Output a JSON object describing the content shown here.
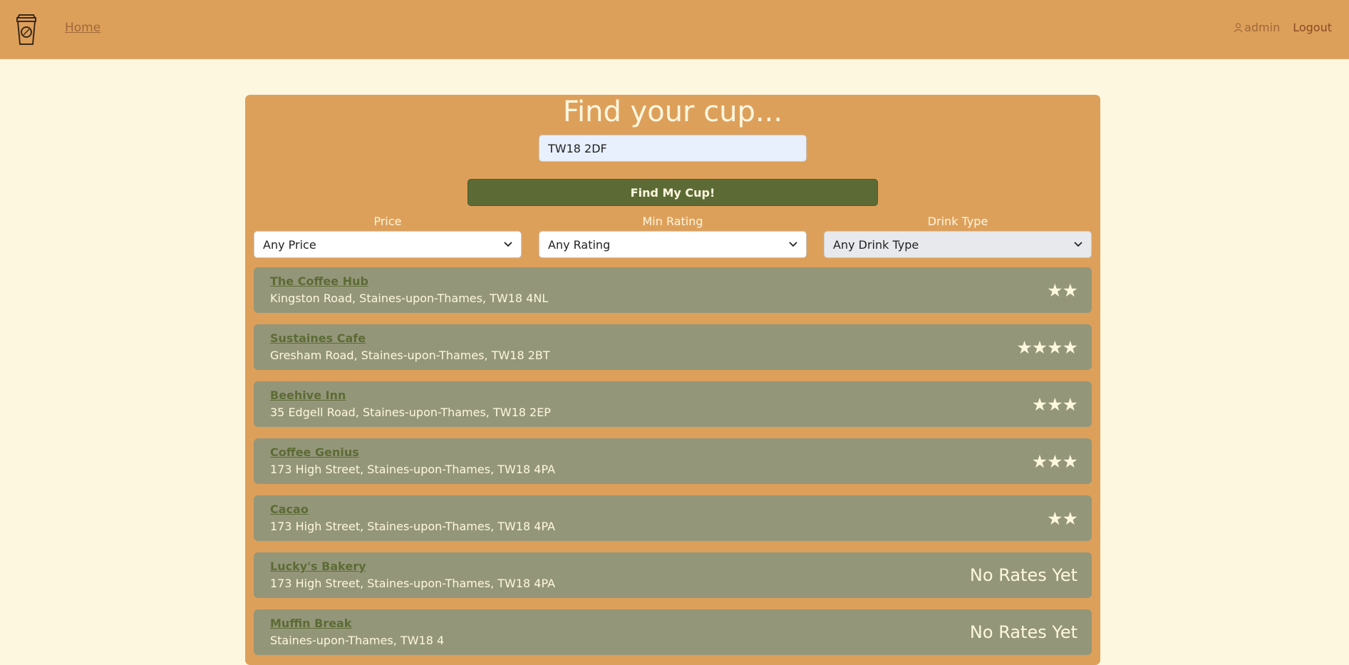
{
  "nav": {
    "home_label": "Home",
    "user_label": "admin",
    "logout_label": "Logout"
  },
  "search": {
    "title": "Find your cup...",
    "postcode_value": "TW18 2DF",
    "button_label": "Find My Cup!"
  },
  "filters": [
    {
      "label": "Price",
      "selected": "Any Price"
    },
    {
      "label": "Min Rating",
      "selected": "Any Rating"
    },
    {
      "label": "Drink Type",
      "selected": "Any Drink Type"
    }
  ],
  "results": [
    {
      "name": "The Coffee Hub",
      "address": "Kingston Road, Staines-upon-Thames, TW18 4NL",
      "rating": "★★"
    },
    {
      "name": "Sustaines Cafe",
      "address": "Gresham Road, Staines-upon-Thames, TW18 2BT",
      "rating": "★★★★"
    },
    {
      "name": "Beehive Inn",
      "address": "35 Edgell Road, Staines-upon-Thames, TW18 2EP",
      "rating": "★★★"
    },
    {
      "name": "Coffee Genius",
      "address": "173 High Street, Staines-upon-Thames, TW18 4PA",
      "rating": "★★★"
    },
    {
      "name": "Cacao",
      "address": "173 High Street, Staines-upon-Thames, TW18 4PA",
      "rating": "★★"
    },
    {
      "name": "Lucky's Bakery",
      "address": "173 High Street, Staines-upon-Thames, TW18 4PA",
      "rating": "No Rates Yet"
    },
    {
      "name": "Muffin Break",
      "address": "Staines-upon-Thames, TW18 4",
      "rating": "No Rates Yet"
    }
  ],
  "colors": {
    "background": "#fdf7df",
    "navbar": "#dda05b",
    "panel": "#dda05b",
    "button": "#5c6b35",
    "result_card": "#949679"
  },
  "icons": [
    "coffee-cup-logo-icon",
    "user-icon",
    "chevron-down-icon"
  ]
}
